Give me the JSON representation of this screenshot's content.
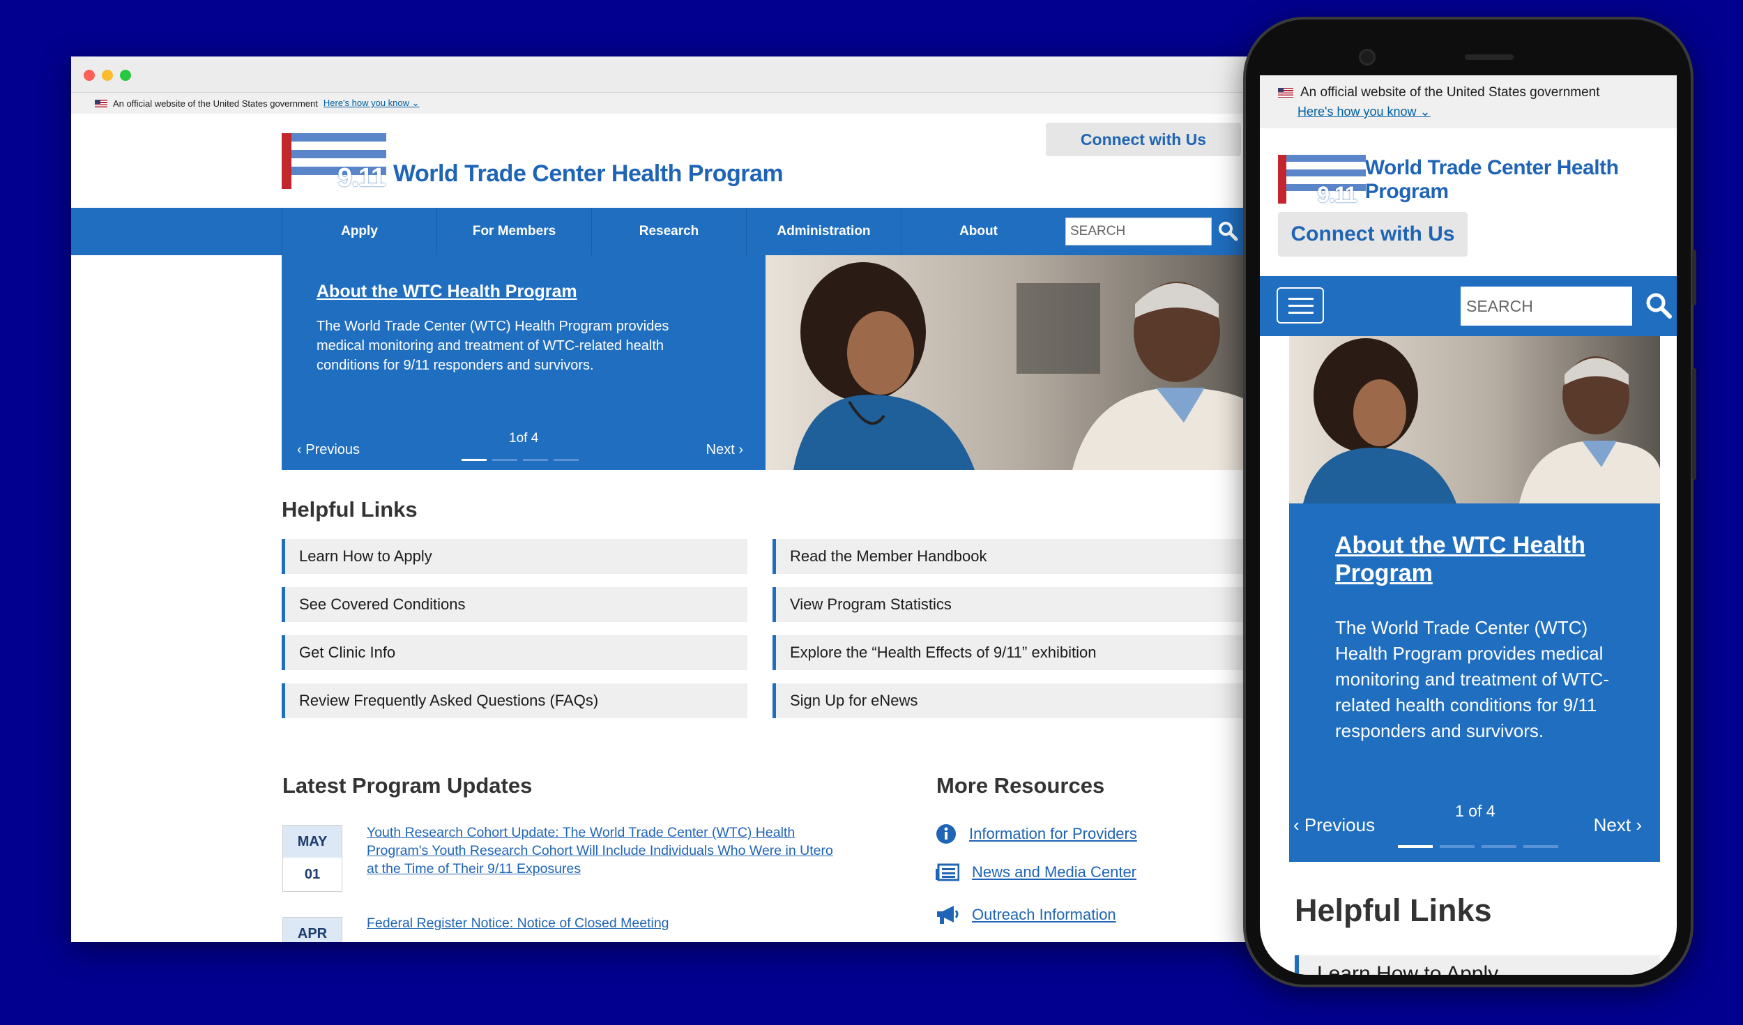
{
  "gov_banner": {
    "text": "An official website of the United States government",
    "link": "Here's how you know"
  },
  "logo": {
    "number": "9.11",
    "title": "World Trade Center Health Program"
  },
  "connect_label": "Connect with Us",
  "nav": {
    "items": [
      "Apply",
      "For Members",
      "Research",
      "Administration",
      "About"
    ]
  },
  "search": {
    "placeholder": "SEARCH"
  },
  "hero": {
    "title": "About the WTC Health Program",
    "description": "The World Trade Center (WTC) Health Program provides medical monitoring and treatment of WTC-related health conditions for 9/11 responders and survivors.",
    "prev": "Previous",
    "next": "Next",
    "counter": "1 of 4",
    "counter_desktop": "1of 4"
  },
  "helpful": {
    "heading": "Helpful Links",
    "left": [
      "Learn How to Apply",
      "See Covered Conditions",
      "Get Clinic Info",
      "Review Frequently Asked Questions (FAQs)"
    ],
    "right": [
      "Read the Member Handbook",
      "View Program Statistics",
      "Explore the “Health Effects of 9/11” exhibition",
      "Sign Up for eNews"
    ]
  },
  "updates": {
    "heading": "Latest Program Updates",
    "items": [
      {
        "month": "MAY",
        "day": "01",
        "title": "Youth Research Cohort Update: The World Trade Center (WTC) Health Program's Youth Research Cohort Will Include Individuals Who Were in Utero at the Time of Their 9/11 Exposures"
      },
      {
        "month": "APR",
        "day": "",
        "title": "Federal Register Notice: Notice of Closed Meeting"
      }
    ]
  },
  "resources": {
    "heading": "More Resources",
    "items": [
      {
        "icon": "info-icon",
        "label": "Information for Providers"
      },
      {
        "icon": "newspaper-icon",
        "label": "News and Media Center"
      },
      {
        "icon": "megaphone-icon",
        "label": "Outreach Information"
      }
    ]
  },
  "colors": {
    "background": "#02008e",
    "primary": "#1f6ec0",
    "brand_text": "#1f64b5",
    "flag_red": "#c4262e"
  }
}
